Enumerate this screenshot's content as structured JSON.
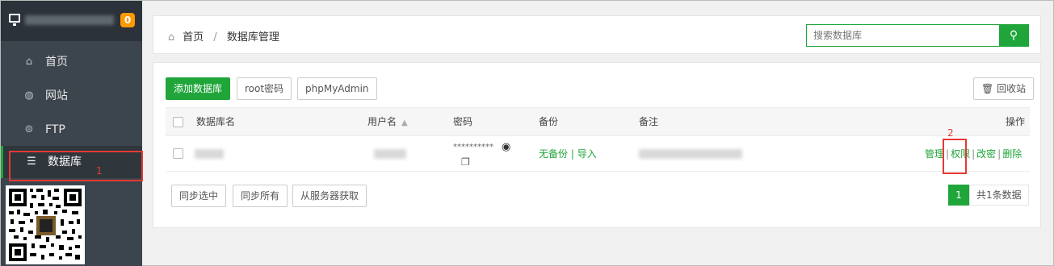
{
  "sidebar": {
    "badge": "0",
    "items": [
      {
        "label": "首页",
        "icon": "home-icon"
      },
      {
        "label": "网站",
        "icon": "globe-icon"
      },
      {
        "label": "FTP",
        "icon": "ftp-icon"
      },
      {
        "label": "数据库",
        "icon": "database-icon"
      }
    ],
    "annotation": "1"
  },
  "header": {
    "breadcrumb_home": "首页",
    "breadcrumb_sep": "/",
    "breadcrumb_current": "数据库管理",
    "search_placeholder": "搜索数据库"
  },
  "toolbar": {
    "add_db": "添加数据库",
    "root_pwd": "root密码",
    "phpmyadmin": "phpMyAdmin",
    "recycle": "回收站"
  },
  "table": {
    "headers": {
      "name": "数据库名",
      "user": "用户名",
      "password": "密码",
      "backup": "备份",
      "note": "备注",
      "ops": "操作"
    },
    "row": {
      "password": "**********",
      "backup_none": "无备份",
      "backup_sep": "|",
      "backup_import": "导入",
      "op_manage": "管理",
      "op_perm": "权限",
      "op_passwd": "改密",
      "op_delete": "删除"
    },
    "annotation": "2"
  },
  "footer": {
    "sync_selected": "同步选中",
    "sync_all": "同步所有",
    "fetch_server": "从服务器获取",
    "page": "1",
    "total": "共1条数据"
  },
  "colors": {
    "accent": "#20a53a",
    "sidebar": "#3c444d",
    "highlight": "#e53935",
    "badge": "#ff9900"
  }
}
